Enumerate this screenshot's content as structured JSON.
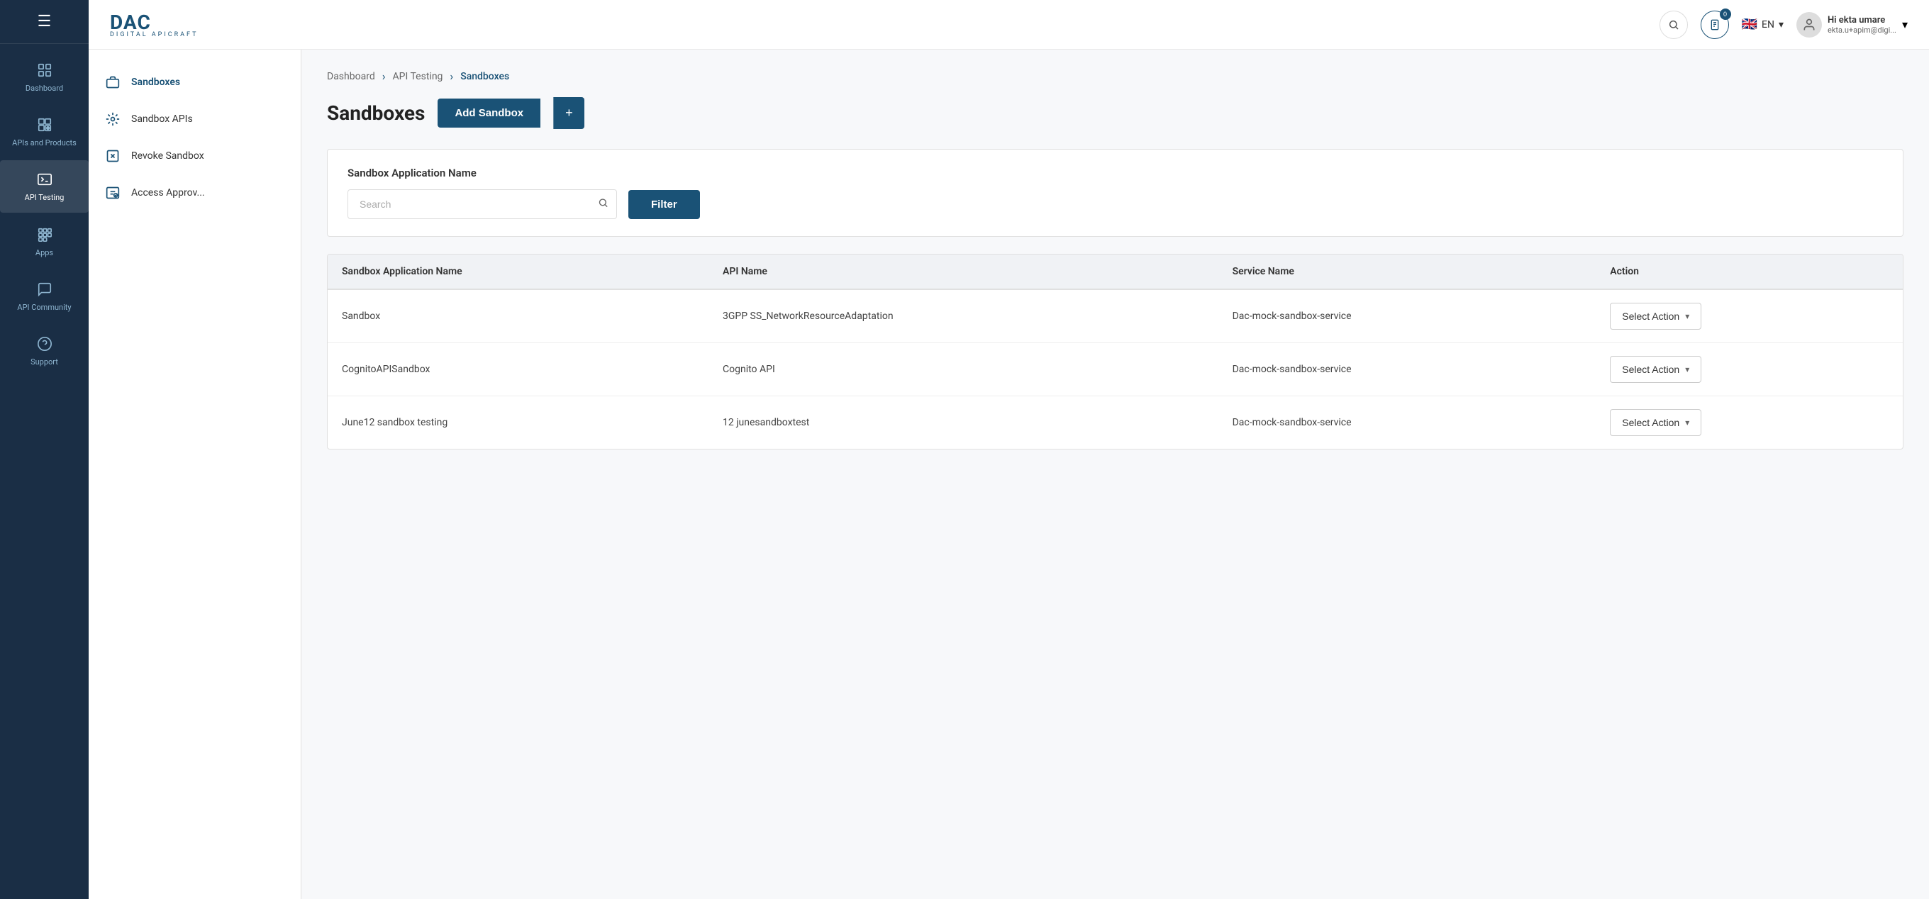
{
  "sidebar": {
    "hamburger": "☰",
    "items": [
      {
        "id": "dashboard",
        "label": "Dashboard",
        "icon": "dashboard"
      },
      {
        "id": "apis",
        "label": "APIs and Products",
        "icon": "api"
      },
      {
        "id": "api-testing",
        "label": "API Testing",
        "icon": "testing",
        "active": true
      },
      {
        "id": "apps",
        "label": "Apps",
        "icon": "apps"
      },
      {
        "id": "api-community",
        "label": "API Community",
        "icon": "community"
      },
      {
        "id": "support",
        "label": "Support",
        "icon": "support"
      }
    ]
  },
  "header": {
    "logo_main": "DAC",
    "logo_sub": "DIGITAL APICRAFT",
    "notif_count": "0",
    "lang": "EN",
    "flag": "🇬🇧",
    "user_greeting": "Hi ekta umare",
    "user_email": "ekta.u+apim@digi..."
  },
  "left_panel": {
    "items": [
      {
        "id": "sandboxes",
        "label": "Sandboxes",
        "active": true
      },
      {
        "id": "sandbox-apis",
        "label": "Sandbox APIs"
      },
      {
        "id": "revoke-sandbox",
        "label": "Revoke Sandbox"
      },
      {
        "id": "access-approv",
        "label": "Access Approv..."
      }
    ]
  },
  "breadcrumb": {
    "items": [
      {
        "label": "Dashboard",
        "active": false
      },
      {
        "label": "API Testing",
        "active": false
      },
      {
        "label": "Sandboxes",
        "active": true
      }
    ]
  },
  "page": {
    "title": "Sandboxes",
    "add_button": "Add Sandbox",
    "plus_label": "+"
  },
  "filter": {
    "section_label": "Sandbox Application Name",
    "search_placeholder": "Search",
    "filter_button": "Filter"
  },
  "table": {
    "columns": [
      "Sandbox Application Name",
      "API Name",
      "Service Name",
      "Action"
    ],
    "rows": [
      {
        "app_name": "Sandbox",
        "api_name": "3GPP SS_NetworkResourceAdaptation",
        "service_name": "Dac-mock-sandbox-service",
        "action_label": "Select Action"
      },
      {
        "app_name": "CognitoAPISandbox",
        "api_name": "Cognito API",
        "service_name": "Dac-mock-sandbox-service",
        "action_label": "Select Action"
      },
      {
        "app_name": "June12 sandbox testing",
        "api_name": "12 junesandboxtest",
        "service_name": "Dac-mock-sandbox-service",
        "action_label": "Select Action"
      }
    ]
  },
  "icons": {
    "hamburger": "☰",
    "search": "🔍",
    "notification": "📋",
    "chevron_down": "▾",
    "chevron_right": "›",
    "user": "👤"
  }
}
